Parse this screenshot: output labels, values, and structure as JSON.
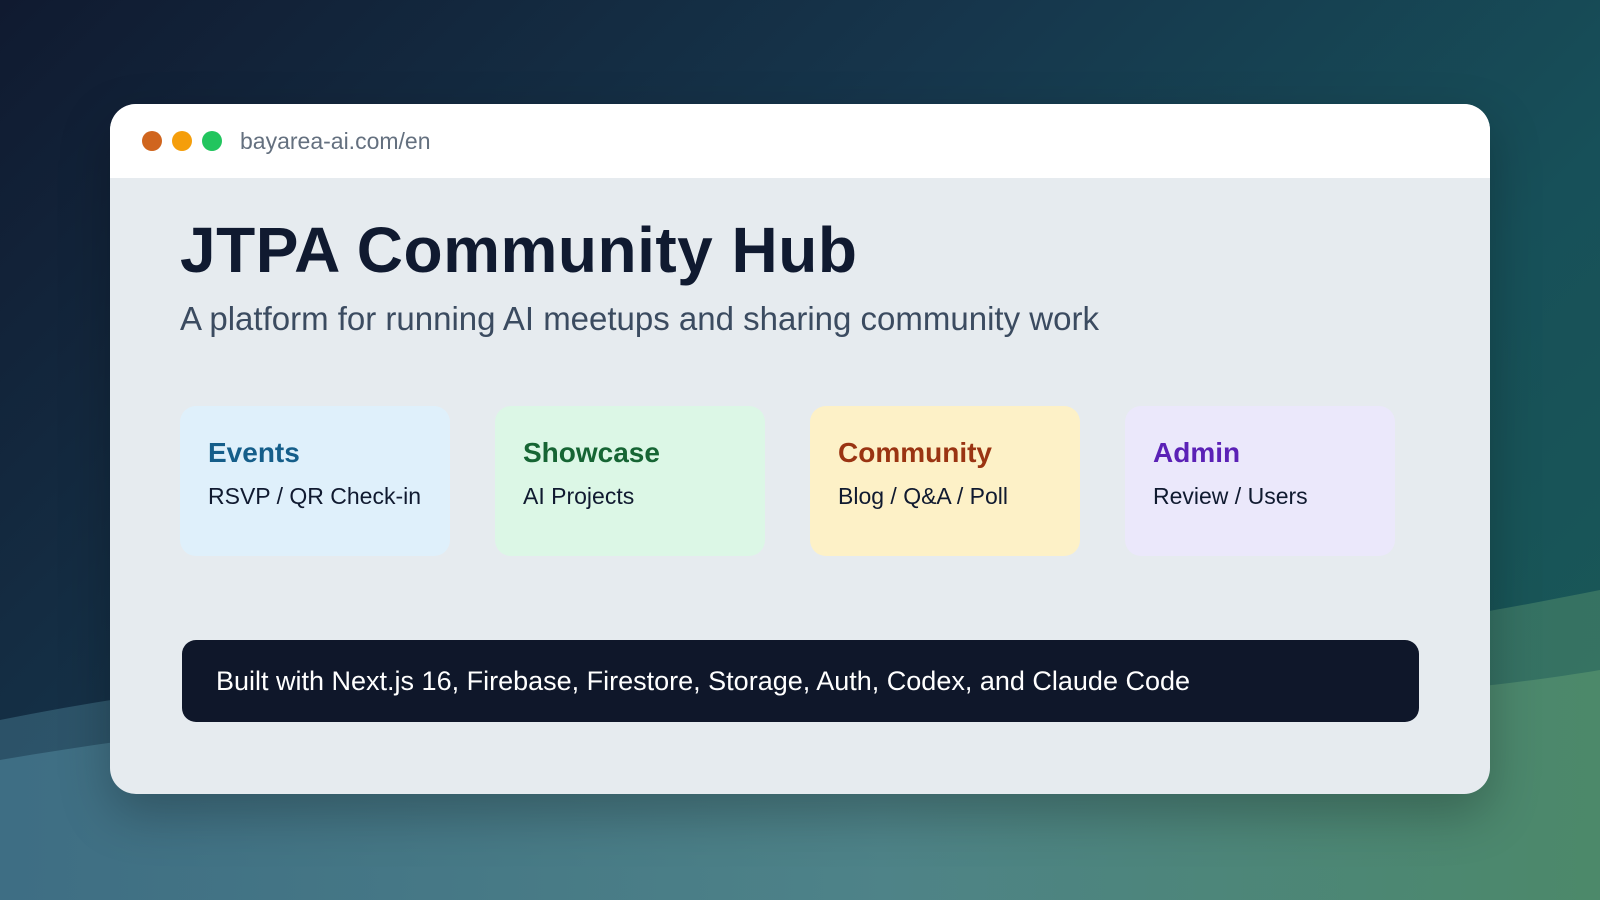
{
  "browser": {
    "url": "bayarea-ai.com/en"
  },
  "hero": {
    "title": "JTPA Community Hub",
    "subtitle": "A platform for running AI meetups and sharing community work"
  },
  "cards": [
    {
      "title": "Events",
      "desc": "RSVP / QR Check-in",
      "bg": "#dff0fb",
      "accent": "#155e8a"
    },
    {
      "title": "Showcase",
      "desc": "AI Projects",
      "bg": "#dcf7e6",
      "accent": "#166534"
    },
    {
      "title": "Community",
      "desc": "Blog / Q&A / Poll",
      "bg": "#fdf1c7",
      "accent": "#9a3412"
    },
    {
      "title": "Admin",
      "desc": "Review / Users",
      "bg": "#ebe8fb",
      "accent": "#5b21b6"
    }
  ],
  "banner": {
    "text": "Built with Next.js 16, Firebase, Firestore, Storage, Auth, Codex, and Claude Code"
  },
  "colors": {
    "window_dots": [
      "#d0651e",
      "#f59e0b",
      "#22c55e"
    ],
    "banner_bg": "#0f172a",
    "title": "#101a30"
  }
}
